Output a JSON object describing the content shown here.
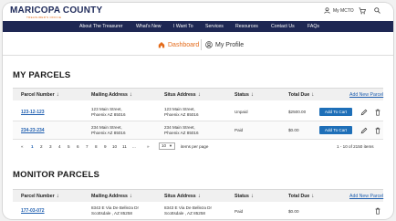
{
  "header": {
    "logo_text": "MARICOPA COUNTY",
    "logo_subtitle": "TREASURER'S OFFICE",
    "mcto_label": "My MCTO"
  },
  "nav": {
    "items": [
      "About The Treasurer",
      "What's New",
      "I Want To",
      "Services",
      "Resources",
      "Contact Us",
      "FAQs"
    ]
  },
  "subnav": {
    "dashboard": "Dashboard",
    "profile": "My Profile"
  },
  "my_parcels": {
    "title": "MY PARCELS",
    "columns": [
      "Parcel Number",
      "Mailing Address",
      "Situs Address",
      "Status",
      "Total Due"
    ],
    "add_link": "Add New Parcel",
    "rows": [
      {
        "parcel": "123-12-123",
        "mailing_1": "123 Main Street,",
        "mailing_2": "Phoenix AZ 85016",
        "situs_1": "123 Main Street,",
        "situs_2": "Phoenix AZ 85016",
        "status": "Unpaid",
        "total": "$2500.00",
        "cart_label": "Add To Cart"
      },
      {
        "parcel": "234-23-234",
        "mailing_1": "234 Main Street,",
        "mailing_2": "Phoenix AZ 85016",
        "situs_1": "234 Main Street,",
        "situs_2": "Phoenix AZ 85016",
        "status": "Paid",
        "total": "$0.00",
        "cart_label": "Add To Cart"
      }
    ],
    "pagination": {
      "prev": "«",
      "pages": [
        "1",
        "2",
        "3",
        "4",
        "5",
        "6",
        "7",
        "8",
        "9",
        "10",
        "11",
        "..."
      ],
      "next": "»",
      "per_page_value": "10",
      "per_page_label": "items per page",
      "range_text": "1 - 10 of 2150 items"
    }
  },
  "monitor_parcels": {
    "title": "MONITOR PARCELS",
    "columns": [
      "Parcel Number",
      "Mailing Address",
      "Situs Address",
      "Status",
      "Total Due"
    ],
    "add_link": "Add New Parcel",
    "rows": [
      {
        "parcel": "177-03-072",
        "mailing_1": "8343 E Via De Belleza Dr",
        "mailing_2": "Scottsdale , AZ 85258",
        "situs_1": "8343 E Via De Belleza Dr",
        "situs_2": "Scottsdale , AZ 85258",
        "status": "Paid",
        "total": "$0.00"
      }
    ]
  },
  "colors": {
    "nav_bg": "#1e2753",
    "accent_orange": "#e46b1a",
    "link_blue": "#1f5fb0",
    "button_blue": "#1e6fb8"
  }
}
